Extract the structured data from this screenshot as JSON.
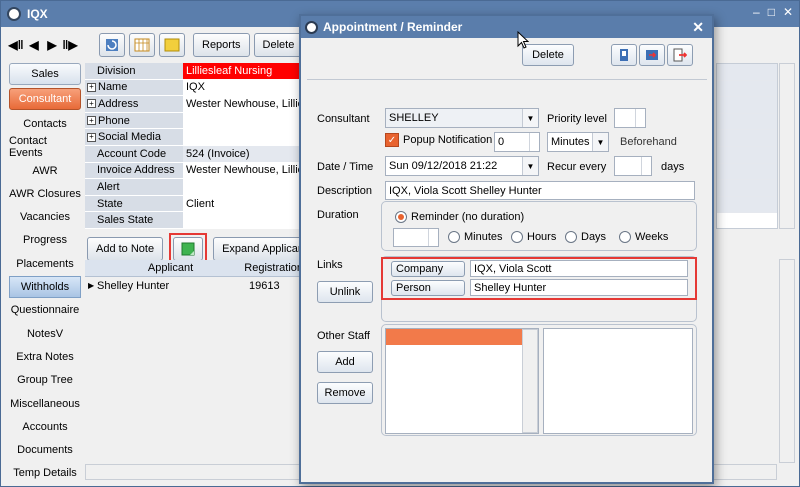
{
  "main": {
    "title": "IQX",
    "toolbar": {
      "reports": "Reports",
      "delete": "Delete"
    },
    "nav": [
      {
        "label": "Sales",
        "state": "tab"
      },
      {
        "label": "Consultant",
        "state": "active"
      },
      {
        "label": "Contacts",
        "state": "plain"
      },
      {
        "label": "Contact Events",
        "state": "plain"
      },
      {
        "label": "AWR",
        "state": "plain"
      },
      {
        "label": "AWR Closures",
        "state": "plain"
      },
      {
        "label": "Vacancies",
        "state": "plain"
      },
      {
        "label": "Progress",
        "state": "plain"
      },
      {
        "label": "Placements",
        "state": "plain"
      },
      {
        "label": "Withholds",
        "state": "selected"
      },
      {
        "label": "Questionnaire",
        "state": "plain"
      },
      {
        "label": "NotesV",
        "state": "plain"
      },
      {
        "label": "Extra Notes",
        "state": "plain"
      },
      {
        "label": "Group Tree",
        "state": "plain"
      },
      {
        "label": "Miscellaneous",
        "state": "plain"
      },
      {
        "label": "Accounts",
        "state": "plain"
      },
      {
        "label": "Documents",
        "state": "plain"
      },
      {
        "label": "Temp Details",
        "state": "plain"
      }
    ],
    "details": [
      {
        "label": "Division",
        "value": "Lilliesleaf Nursing",
        "expandable": false,
        "highlight": true
      },
      {
        "label": "Name",
        "value": "IQX",
        "expandable": true
      },
      {
        "label": "Address",
        "value": "Wester Newhouse, Lillie",
        "expandable": true
      },
      {
        "label": "Phone",
        "value": "",
        "expandable": true
      },
      {
        "label": "Social Media",
        "value": "",
        "expandable": true
      },
      {
        "label": "Account Code",
        "value": "524 (Invoice)",
        "expandable": false
      },
      {
        "label": "Invoice Address",
        "value": "Wester Newhouse, Lillie",
        "expandable": false
      },
      {
        "label": "Alert",
        "value": "",
        "expandable": false
      },
      {
        "label": "State",
        "value": "Client",
        "expandable": false
      },
      {
        "label": "Sales State",
        "value": "",
        "expandable": false
      }
    ],
    "actions": {
      "add_to_note": "Add to Note",
      "expand_applicant": "Expand Applicant"
    },
    "applicant_grid": {
      "headers": [
        "Applicant",
        "Registration"
      ],
      "rows": [
        {
          "applicant": "Shelley Hunter",
          "registration": "19613"
        }
      ]
    }
  },
  "dialog": {
    "title": "Appointment / Reminder",
    "delete_label": "Delete",
    "consultant_label": "Consultant",
    "consultant_value": "SHELLEY",
    "priority_label": "Priority level",
    "popup_label": "Popup Notification",
    "popup_value": "0",
    "popup_unit": "Minutes",
    "beforehand_label": "Beforehand",
    "datetime_label": "Date / Time",
    "datetime_value": "Sun 09/12/2018 21:22",
    "recur_label": "Recur every",
    "recur_unit": "days",
    "description_label": "Description",
    "description_value": "IQX, Viola Scott Shelley Hunter",
    "duration_label": "Duration",
    "reminder_label": "Reminder (no duration)",
    "minutes_label": "Minutes",
    "hours_label": "Hours",
    "days_label": "Days",
    "weeks_label": "Weeks",
    "links_label": "Links",
    "unlink_label": "Unlink",
    "company_label": "Company",
    "company_value": "IQX, Viola Scott",
    "person_label": "Person",
    "person_value": "Shelley Hunter",
    "other_staff_label": "Other Staff",
    "add_label": "Add",
    "remove_label": "Remove"
  },
  "colors": {
    "accent": "#e8632f",
    "title_bar": "#5b7eac",
    "highlight_red": "#e53935"
  }
}
